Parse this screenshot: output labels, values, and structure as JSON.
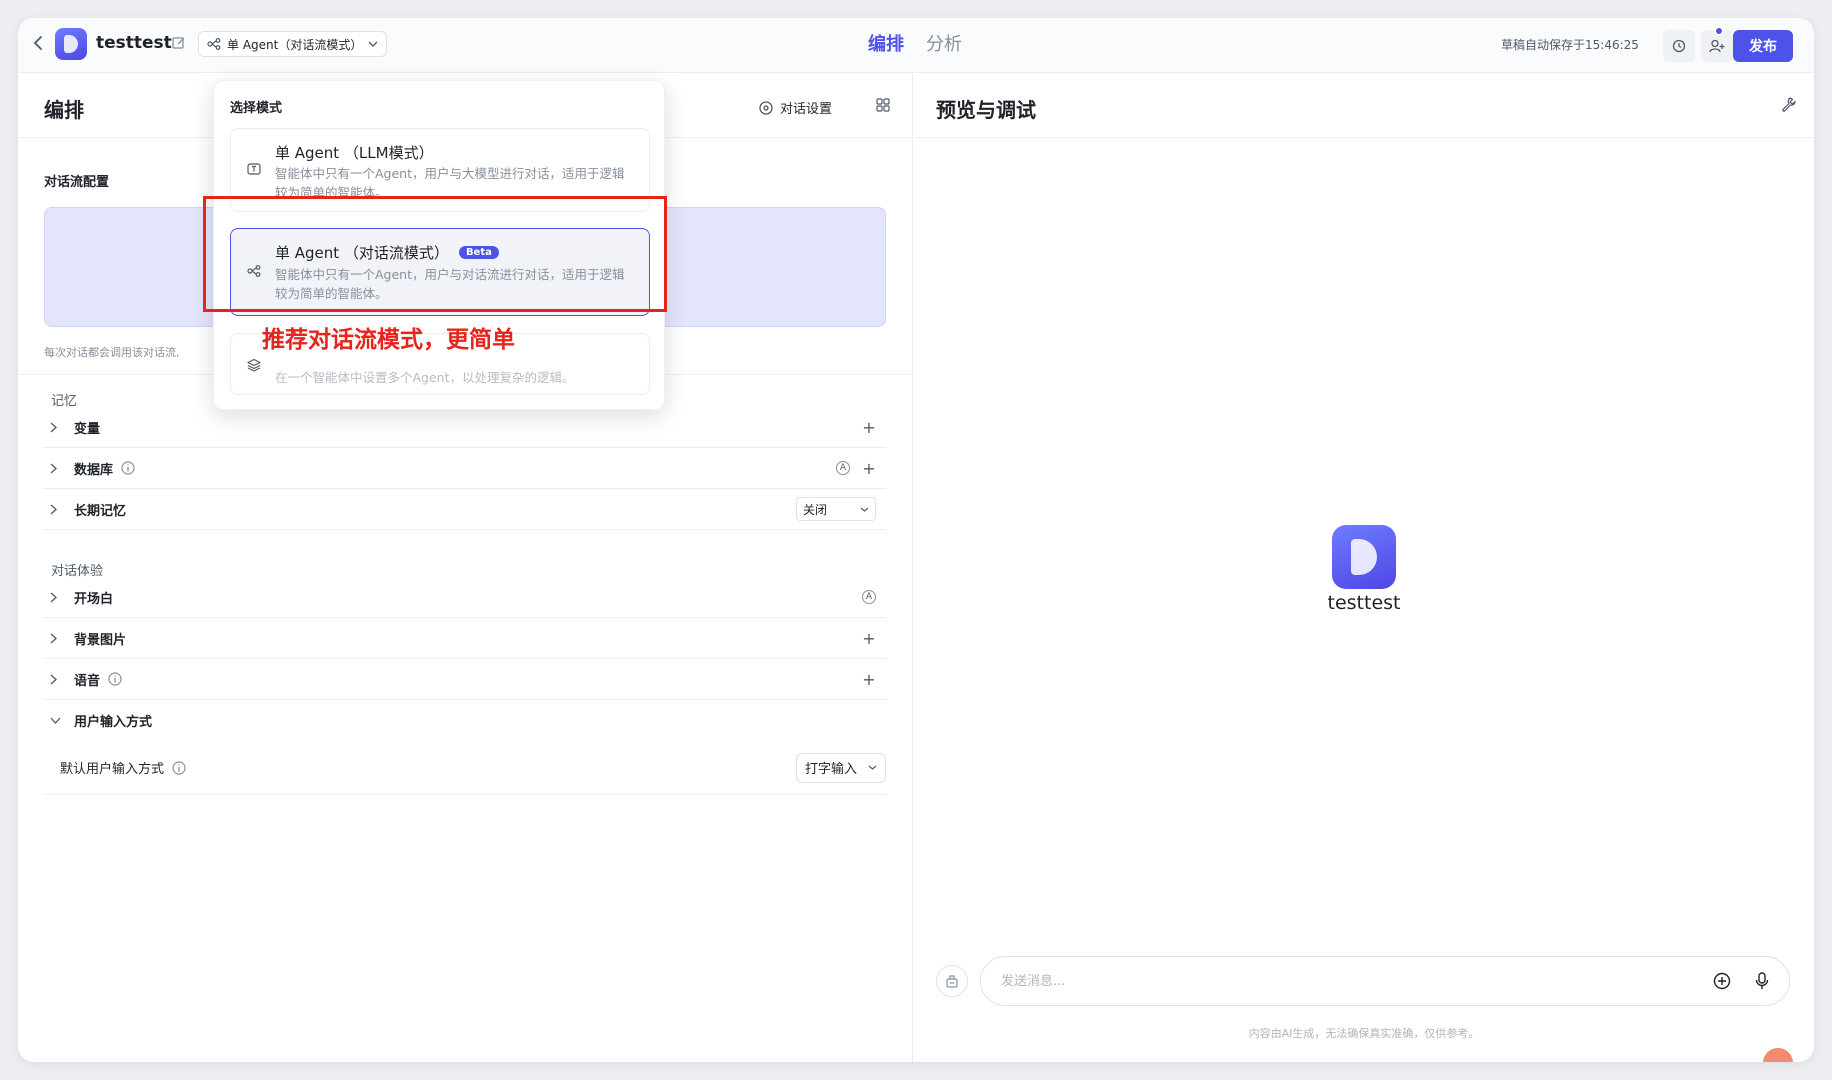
{
  "topbar": {
    "app_name": "testtest",
    "mode_label": "单 Agent（对话流模式）",
    "tabs": [
      {
        "label": "编排",
        "active": true
      },
      {
        "label": "分析",
        "active": false
      }
    ],
    "autosave": "草稿自动保存于15:46:25",
    "publish_label": "发布"
  },
  "left": {
    "title": "编排",
    "conv_settings": "对话设置",
    "flow_config_label": "对话流配置",
    "flow_note": "每次对话都会调用该对话流,",
    "memory_group": "记忆",
    "rows_memory": [
      {
        "label": "变量"
      },
      {
        "label": "数据库"
      },
      {
        "label": "长期记忆",
        "select_value": "关闭"
      }
    ],
    "experience_group": "对话体验",
    "rows_experience": [
      {
        "label": "开场白"
      },
      {
        "label": "背景图片"
      },
      {
        "label": "语音"
      },
      {
        "label": "用户输入方式"
      }
    ],
    "default_input_label": "默认用户输入方式",
    "default_input_value": "打字输入"
  },
  "dropdown": {
    "title": "选择模式",
    "options": [
      {
        "title": "单 Agent （LLM模式）",
        "desc": "智能体中只有一个Agent，用户与大模型进行对话，适用于逻辑较为简单的智能体。",
        "badge": ""
      },
      {
        "title": "单 Agent （对话流模式）",
        "desc": "智能体中只有一个Agent，用户与对话流进行对话，适用于逻辑较为简单的智能体。",
        "badge": "Beta"
      },
      {
        "title": "",
        "desc": "在一个智能体中设置多个Agent，以处理复杂的逻辑。",
        "badge": ""
      }
    ],
    "annotation": "推荐对话流模式，更简单"
  },
  "right": {
    "title": "预览与调试",
    "bot_name": "testtest",
    "input_placeholder": "发送消息...",
    "disclaimer": "内容由AI生成，无法确保真实准确，仅供参考。"
  },
  "colors": {
    "accent": "#4d53e8",
    "annotation": "#e8231b"
  }
}
